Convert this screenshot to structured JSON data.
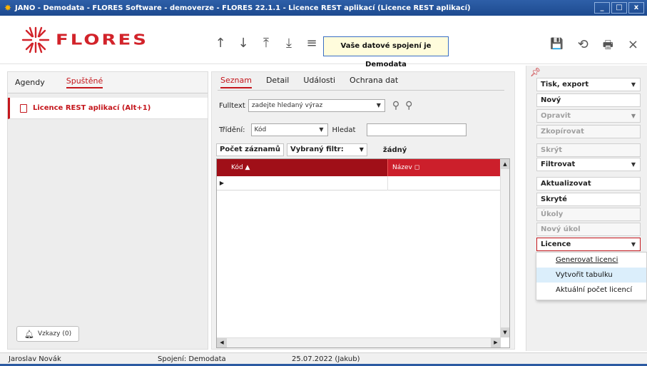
{
  "window": {
    "title": "JANO - Demodata - FLORES Software - demoverze - FLORES 22.1.1 - Licence REST aplikací (Licence REST aplikací)",
    "minimize": "_",
    "maximize": "□",
    "close": "x"
  },
  "logo": {
    "text": "FLORES",
    "color": "#d2232a"
  },
  "toolbar": {
    "nav_icons": [
      "↑",
      "↓",
      "⤒",
      "⤓",
      "≡"
    ],
    "connection_banner": "Vaše datové spojení je Demodata",
    "right_icons": [
      "💾",
      "⟲",
      "🖶",
      "×"
    ]
  },
  "left_panel": {
    "tabs": [
      {
        "label": "Agendy"
      },
      {
        "label": "Spuštěné"
      }
    ],
    "running_item": "Licence REST aplikací (Alt+1)",
    "messages_button": "Vzkazy (0)"
  },
  "center": {
    "tabs": [
      {
        "label": "Seznam"
      },
      {
        "label": "Detail"
      },
      {
        "label": "Události"
      },
      {
        "label": "Ochrana dat"
      }
    ],
    "fulltext_label": "Fulltext",
    "fulltext_value": "zadejte hledaný výraz",
    "sort_label": "Třídění:",
    "sort_value": "Kód",
    "search_label": "Hledat",
    "search_value": "",
    "count_button": "Počet záznamů",
    "filter_button": "Vybraný filtr:",
    "filter_value": "žádný",
    "columns": [
      "Kód ▲",
      "Název ◻"
    ]
  },
  "right_panel": {
    "buttons": [
      {
        "label": "Tisk, export",
        "disabled": false,
        "dropdown": true
      },
      {
        "label": "Nový",
        "disabled": false,
        "dropdown": false
      },
      {
        "label": "Opravit",
        "disabled": true,
        "dropdown": true
      },
      {
        "label": "Zkopírovat",
        "disabled": true,
        "dropdown": false
      },
      {
        "label": "Skrýt",
        "disabled": true,
        "dropdown": false
      },
      {
        "label": "Filtrovat",
        "disabled": false,
        "dropdown": true
      },
      {
        "label": "Aktualizovat",
        "disabled": false,
        "dropdown": false
      },
      {
        "label": "Skryté",
        "disabled": false,
        "dropdown": false
      },
      {
        "label": "Úkoly",
        "disabled": true,
        "dropdown": false
      },
      {
        "label": "Nový úkol",
        "disabled": true,
        "dropdown": false
      },
      {
        "label": "Licence",
        "disabled": false,
        "dropdown": true
      }
    ],
    "licence_menu": [
      {
        "label": "Generovat licenci",
        "highlighted": false
      },
      {
        "label": "Vytvořit tabulku",
        "highlighted": true
      },
      {
        "label": "Aktuální počet licencí",
        "highlighted": false
      }
    ]
  },
  "status_bar": {
    "user": "Jaroslav Novák",
    "connection": "Spojení: Demodata",
    "date": "25.07.2022 (Jakub)"
  }
}
